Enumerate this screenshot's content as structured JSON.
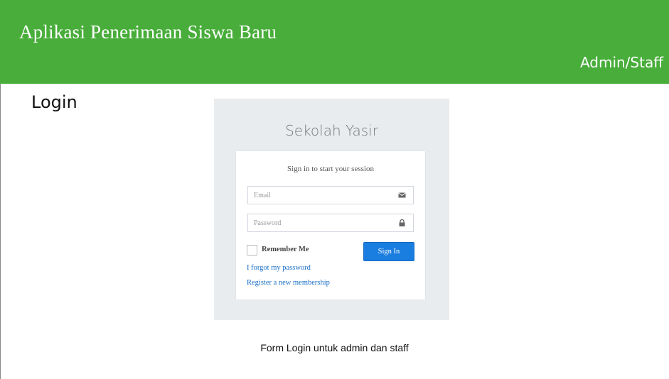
{
  "header": {
    "title": "Aplikasi Penerimaan Siswa Baru",
    "role": "Admin/Staff",
    "background_color": "#48ad3a"
  },
  "page": {
    "heading": "Login",
    "caption": "Form Login untuk admin dan staff"
  },
  "login": {
    "brand": "Sekolah Yasir",
    "session_message": "Sign in to start your session",
    "email": {
      "placeholder": "Email",
      "value": "",
      "icon": "envelope-icon"
    },
    "password": {
      "placeholder": "Password",
      "value": "",
      "icon": "lock-icon"
    },
    "remember_label": "Remember Me",
    "remember_checked": false,
    "signin_label": "Sign In",
    "forgot_link": "I forgot my password",
    "register_link": "Register a new membership",
    "button_color": "#1a7ee0",
    "link_color": "#1a6fc7",
    "panel_color": "#e9ecef"
  }
}
